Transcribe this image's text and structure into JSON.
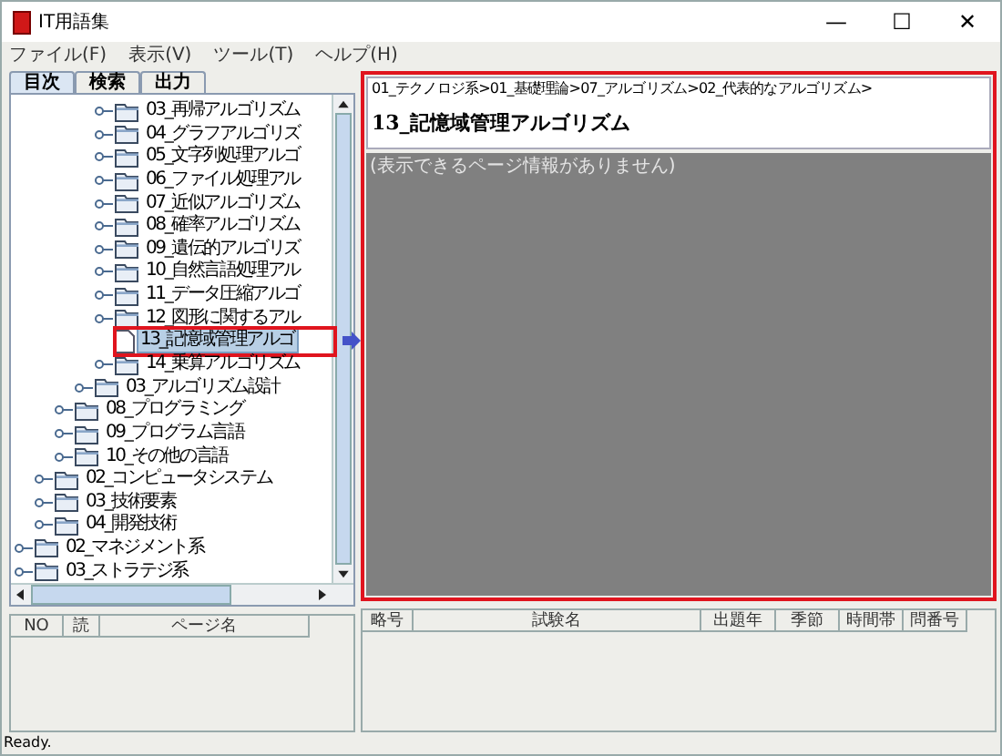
{
  "window": {
    "title": "IT用語集",
    "controls": [
      "—",
      "☐",
      "✕"
    ]
  },
  "menu": [
    "ファイル(F)",
    "表示(V)",
    "ツール(T)",
    "ヘルプ(H)"
  ],
  "tabs": [
    {
      "label": "目次",
      "selected": true
    },
    {
      "label": "検索",
      "selected": false
    },
    {
      "label": "出力",
      "selected": false
    }
  ],
  "tree": {
    "items": [
      {
        "children": [
          {
            "children": [
              {
                "children": [
                  {
                    "children": [
                      {
                        "label": "03_再帰アルゴリズム",
                        "kind": "folder",
                        "selected": false
                      },
                      {
                        "label": "04_グラフアルゴリズ",
                        "kind": "folder",
                        "selected": false
                      },
                      {
                        "label": "05_文字列処理アルゴ",
                        "kind": "folder",
                        "selected": false
                      },
                      {
                        "label": "06_ファイル処理アル",
                        "kind": "folder",
                        "selected": false
                      },
                      {
                        "label": "07_近似アルゴリズム",
                        "kind": "folder",
                        "selected": false
                      },
                      {
                        "label": "08_確率アルゴリズム",
                        "kind": "folder",
                        "selected": false
                      },
                      {
                        "label": "09_遺伝的アルゴリズ",
                        "kind": "folder",
                        "selected": false
                      },
                      {
                        "label": "10_自然言語処理アル",
                        "kind": "folder",
                        "selected": false
                      },
                      {
                        "label": "11_データ圧縮アルゴ",
                        "kind": "folder",
                        "selected": false
                      },
                      {
                        "label": "12_図形に関するアル",
                        "kind": "folder",
                        "selected": false
                      },
                      {
                        "label": "13_記憶域管理アルゴ",
                        "kind": "file",
                        "selected": true
                      },
                      {
                        "label": "14_乗算アルゴリズム",
                        "kind": "folder",
                        "selected": false
                      }
                    ]
                  },
                  {
                    "label": "03_アルゴリズム設計",
                    "kind": "folder",
                    "selected": false
                  }
                ]
              },
              {
                "label": "08_プログラミング",
                "kind": "folder",
                "selected": false
              },
              {
                "label": "09_プログラム言語",
                "kind": "folder",
                "selected": false
              },
              {
                "label": "10_その他の言語",
                "kind": "folder",
                "selected": false
              }
            ]
          },
          {
            "label": "02_コンピュータシステム",
            "kind": "folder",
            "selected": false
          },
          {
            "label": "03_技術要素",
            "kind": "folder",
            "selected": false
          },
          {
            "label": "04_開発技術",
            "kind": "folder",
            "selected": false
          }
        ]
      },
      {
        "label": "02_マネジメント系",
        "kind": "folder",
        "selected": false
      },
      {
        "label": "03_ストラテジ系",
        "kind": "folder",
        "selected": false
      }
    ]
  },
  "page": {
    "breadcrumb": "01_テクノロジ系>01_基礎理論>07_アルゴリズム>02_代表的なアルゴリズム>",
    "title": "13_記憶域管理アルゴリズム",
    "message": "(表示できるページ情報がありません)"
  },
  "page_table": {
    "columns": [
      "NO",
      "読",
      "ページ名"
    ]
  },
  "exam_table": {
    "columns": [
      "略号",
      "試験名",
      "出題年",
      "季節",
      "時間帯",
      "問番号"
    ]
  },
  "status_bar": "Ready."
}
